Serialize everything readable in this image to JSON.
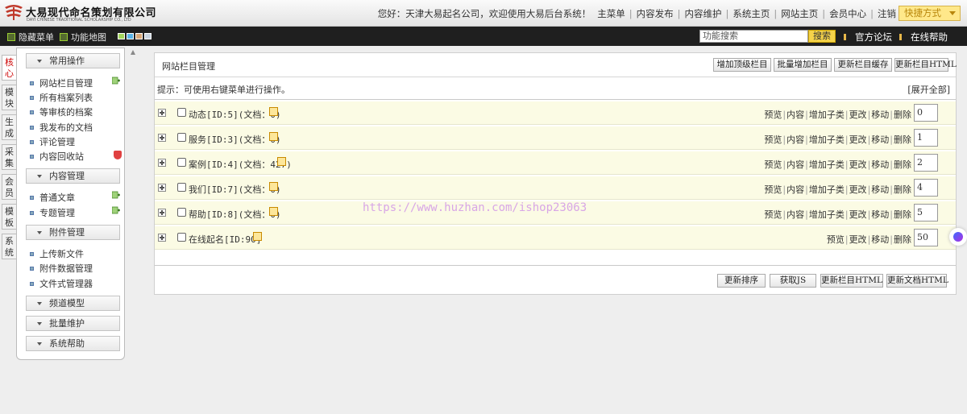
{
  "header": {
    "logo_cn": "大易现代命名策划有限公司",
    "logo_en": "DAYI CHINESE TRADITIONAL SCHOLARSHIP CO., LTD",
    "greeting": "您好：天津大易起名公司，欢迎使用大易后台系统！",
    "nav": [
      "主菜单",
      "内容发布",
      "内容维护",
      "系统主页",
      "网站主页",
      "会员中心",
      "注销"
    ],
    "quick": "快捷方式"
  },
  "bar": {
    "hide_menu": "隐藏菜单",
    "function_map": "功能地图",
    "swatch_colors": [
      "#a4d65e",
      "#5ab4e8",
      "#d9a878",
      "#c7d3e0"
    ],
    "search_placeholder": "功能搜索",
    "search_button": "搜索",
    "forum": "官方论坛",
    "help": "在线帮助"
  },
  "vtabs": [
    "核心",
    "模块",
    "生成",
    "采集",
    "会员",
    "模板",
    "系统"
  ],
  "sidebar": {
    "sections": [
      "常用操作",
      "内容管理",
      "附件管理",
      "频道模型",
      "批量维护",
      "系统帮助"
    ],
    "common": [
      "网站栏目管理",
      "所有档案列表",
      "等审核的档案",
      "我发布的文档",
      "评论管理",
      "内容回收站"
    ],
    "content": [
      "普通文章",
      "专题管理"
    ],
    "attach": [
      "上传新文件",
      "附件数据管理",
      "文件式管理器"
    ]
  },
  "panel": {
    "title": "网站栏目管理",
    "buttons": [
      "增加顶级栏目",
      "批量增加栏目",
      "更新栏目缓存",
      "更新栏目HTML"
    ],
    "tip": "提示：可使用右键菜单进行操作。",
    "expand": "[展开全部]",
    "op_labels": [
      "预览",
      "内容",
      "增加子类",
      "更改",
      "移动",
      "删除"
    ],
    "rows": [
      {
        "name": "动态[ID:5](文档：0)",
        "order": "0"
      },
      {
        "name": "服务[ID:3](文档：0)",
        "order": "1"
      },
      {
        "name": "案例[ID:4](文档：427)",
        "order": "2"
      },
      {
        "name": "我们[ID:7](文档：0)",
        "order": "4"
      },
      {
        "name": "帮助[ID:8](文档：0)",
        "order": "5"
      },
      {
        "name": "在线起名[ID:90]",
        "order": "50"
      }
    ],
    "footer_buttons": [
      "更新排序",
      "获取JS",
      "更新栏目HTML",
      "更新文档HTML"
    ]
  },
  "watermark": "https://www.huzhan.com/ishop23063"
}
